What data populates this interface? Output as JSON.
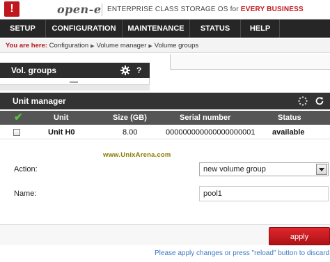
{
  "header": {
    "logo_glyph": "!",
    "logo_text": "open-e",
    "tagline_prefix": "ENTERPRISE CLASS STORAGE OS for ",
    "tagline_highlight": "EVERY BUSINESS"
  },
  "nav": {
    "items": [
      "SETUP",
      "CONFIGURATION",
      "MAINTENANCE",
      "STATUS",
      "HELP"
    ]
  },
  "breadcrumb": {
    "lead": "You are here:",
    "items": [
      "Configuration",
      "Volume manager",
      "Volume groups"
    ]
  },
  "vol_groups": {
    "title": "Vol. groups",
    "help": "?"
  },
  "unit_manager": {
    "title": "Unit manager",
    "columns": [
      "Unit",
      "Size (GB)",
      "Serial number",
      "Status"
    ],
    "rows": [
      {
        "unit": "Unit H0",
        "size": "8.00",
        "serial": "000000000000000000001",
        "status": "available"
      }
    ]
  },
  "watermark": "www.UnixArena.com",
  "form": {
    "action_label": "Action:",
    "action_value": "new volume group",
    "name_label": "Name:",
    "name_value": "pool1"
  },
  "apply_label": "apply",
  "notice": "Please apply changes or press \"reload\" button to discard",
  "colors": {
    "brand_red": "#c0161d",
    "nav_bg": "#262626",
    "link_blue": "#3d78c4"
  }
}
